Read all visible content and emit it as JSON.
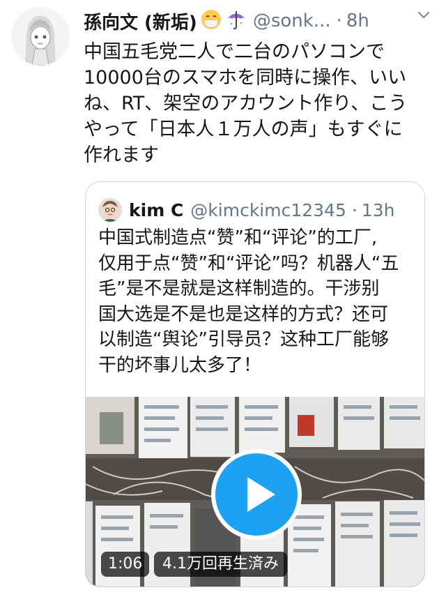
{
  "tweet": {
    "display_name": "孫向文 (新垢)",
    "emojis": [
      "face-with-medical-mask-icon",
      "umbrella-icon"
    ],
    "handle": "@sonk...",
    "separator": "·",
    "time": "8h",
    "text": "中国五毛党二人で二台のパソコンで\n10000台のスマホを同時に操作、いい\nね、RT、架空のアカウント作り、こう\nやって「日本人１万人の声」もすぐに\n作れます"
  },
  "quoted_tweet": {
    "display_name": "kim C",
    "handle": "@kimckimc12345",
    "separator": "·",
    "time": "13h",
    "text": "中国式制造点“赞”和“评论”的工厂,\n仅用于点“赞”和“评论”吗？机器人“五\n毛”是不是就是这样制造的。干涉别\n国大选是不是也是这样的方式？还可\n以制造“舆论”引导员？这种工厂能够\n干的坏事儿太多了！",
    "video": {
      "duration": "1:06",
      "views": "4.1万回再生済み"
    }
  },
  "colors": {
    "text": "#14171a",
    "secondary": "#657786",
    "accent": "#1da1f2",
    "border": "#ccd6dd"
  }
}
